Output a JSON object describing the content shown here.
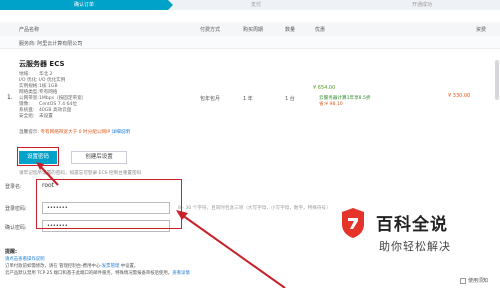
{
  "steps": [
    "确认订单",
    "支付",
    "开通成功"
  ],
  "table_headers": {
    "product": "产品名称",
    "pay_type": "付费方式",
    "period": "购买周期",
    "qty": "数量",
    "discount": "优惠",
    "cost": "资费"
  },
  "vendor": "服务商: 阿里云计算有限公司",
  "product": {
    "index": "1.",
    "name": "云服务器 ECS",
    "specs": [
      {
        "k": "地域:",
        "v": "华北 2"
      },
      {
        "k": "I/O 优化:",
        "v": "I/O 优化实例"
      },
      {
        "k": "实例规格:",
        "v": "1核 1GB"
      },
      {
        "k": "网络类型:",
        "v": "专有网络"
      },
      {
        "k": "公网带宽:",
        "v": "1Mbps（按固定带宽）"
      },
      {
        "k": "镜像:",
        "v": "CentOS 7.4 64位"
      },
      {
        "k": "系统盘:",
        "v": "40GB 高效云盘"
      },
      {
        "k": "安全组:",
        "v": "未设置"
      }
    ],
    "pay_type": "包年包月",
    "period": "1 年",
    "qty": "1 台",
    "price_orig": "¥ 654.00",
    "discount_line": "云服务器计算1年享8.5折",
    "save_line": "省:¥ 98.10",
    "price_final": "¥ 330.00",
    "tip_label": "温馨提示:",
    "tip_warn": "专有网络带宽大于 0 时分配公网IP",
    "tip_link": "详细说明"
  },
  "login": {
    "tab_active": "设置密码",
    "tab_other": "创建后设置",
    "note_text": "请牢记您所设置的密码，如遗忘可登录 ECS 控制台重置密码",
    "label_login": "登录名:",
    "login_value": "root",
    "label_password": "登录密码:",
    "password_value": "•••••••",
    "password_hint": "8 - 30 个字符，且同时包含三项（大写字母，小写字母，数字，特殊符号）",
    "label_confirm": "确认密码:",
    "confirm_value": "•••••••"
  },
  "tips": {
    "title": "提醒:",
    "link": "请点击查看操作说明",
    "line1": "订单付款前如需修改，请在 管理控制台-费用中心-",
    "line1_link": "发票管理",
    "line1_tail": " 中设置。",
    "line2": "云产品默认禁用 TCP 25 端口和基于此端口的邮件服务，特殊情况需报备审核后使用。",
    "line2_link": "查看详情"
  },
  "checkbox_label": "使用须知",
  "watermark": {
    "title": "百科全说",
    "subtitle": "助你轻松解决"
  },
  "colors": {
    "accent": "#00a2ca",
    "highlight": "#c8202a",
    "price": "#e05a1a"
  }
}
